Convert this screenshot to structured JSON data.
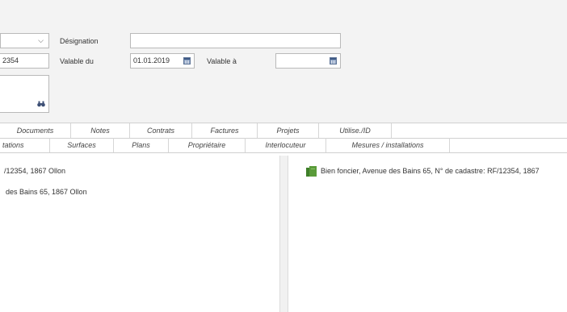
{
  "form": {
    "dropdown_partial_value": "",
    "designation_label": "Désignation",
    "designation_value": "",
    "id_partial": "2354",
    "valable_du_label": "Valable du",
    "valable_du_value": "01.01.2019",
    "valable_a_label": "Valable à",
    "valable_a_value": ""
  },
  "tabs_row1": [
    "Documents",
    "Notes",
    "Contrats",
    "Factures",
    "Projets",
    "Utilise./ID"
  ],
  "tabs_row2": [
    "tations",
    "Surfaces",
    "Plans",
    "Propriétaire",
    "Interlocuteur",
    "Mesures / installations"
  ],
  "left_panel": {
    "line1": "/12354, 1867 Ollon",
    "line2": "des Bains 65, 1867 Ollon"
  },
  "right_panel": {
    "item_text": "Bien foncier, Avenue des Bains 65, N° de cadastre: RF/12354, 1867",
    "item_icon": "property-icon"
  },
  "colors": {
    "panel_bg": "#f3f3f3",
    "icon_green": "#5a9b3a"
  }
}
